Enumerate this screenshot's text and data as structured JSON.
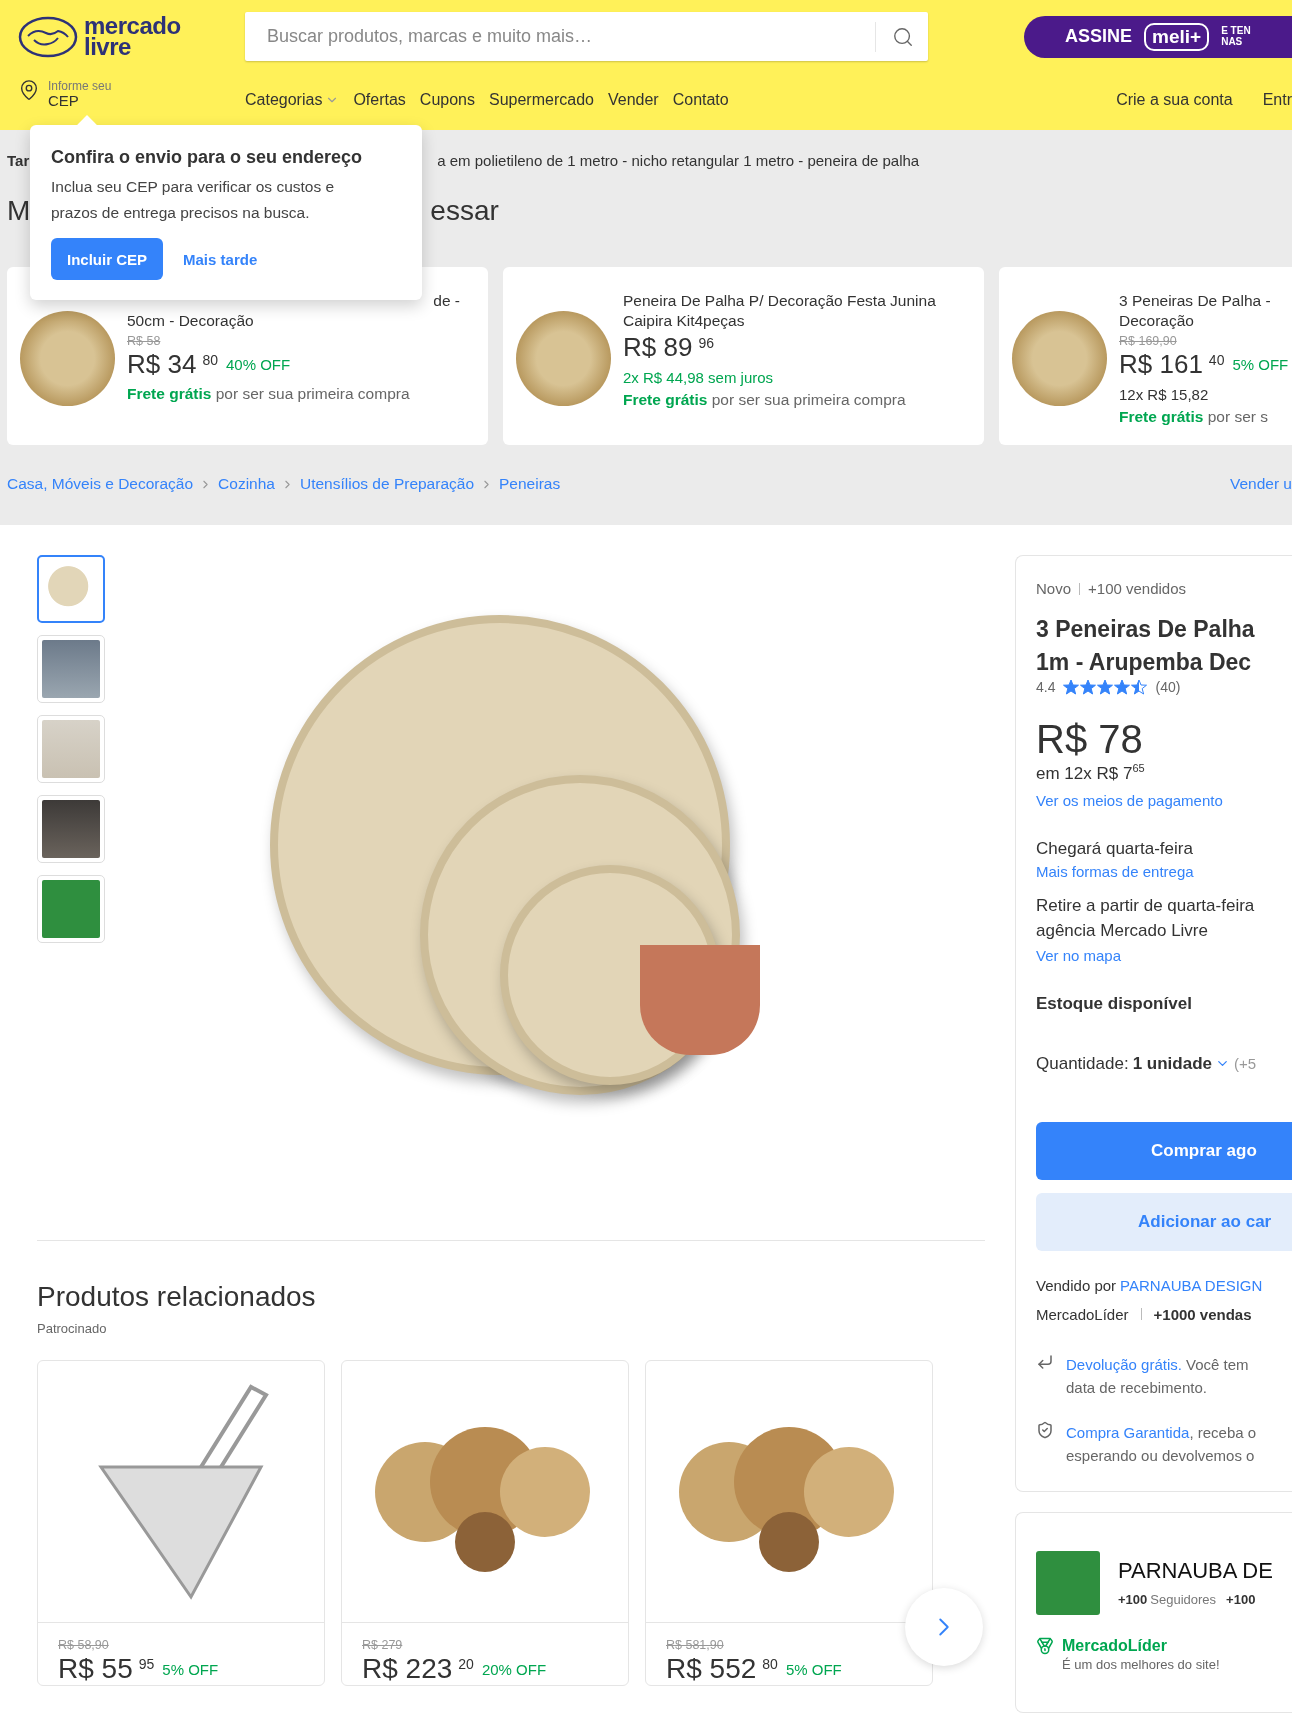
{
  "header": {
    "logo": {
      "line1": "mercado",
      "line2": "livre"
    },
    "search": {
      "placeholder": "Buscar produtos, marcas e muito mais…"
    },
    "promo": {
      "action": "ASSINE",
      "brand": "meli+",
      "tagline": [
        "E TEN",
        "NAS"
      ]
    },
    "location": {
      "label": "Informe seu",
      "value": "CEP"
    },
    "nav": [
      {
        "label": "Categorias",
        "dropdown": true
      },
      {
        "label": "Ofertas",
        "dropdown": false
      },
      {
        "label": "Cupons",
        "dropdown": false
      },
      {
        "label": "Supermercado",
        "dropdown": false
      },
      {
        "label": "Vender",
        "dropdown": false
      },
      {
        "label": "Contato",
        "dropdown": false
      }
    ],
    "account": [
      "Crie a sua conta",
      "Entr"
    ]
  },
  "popup": {
    "title": "Confira o envio para o seu endereço",
    "text": "Inclua seu CEP para verificar os custos e prazos de entrega precisos na busca.",
    "primary": "Incluir CEP",
    "secondary": "Mais tarde"
  },
  "search_context": {
    "prefix": "Tar",
    "text": "a em polietileno de 1 metro - nicho retangular 1 metro - peneira de palha"
  },
  "recommendations": {
    "heading_start": "M",
    "heading_end": "essar",
    "cards": [
      {
        "title_lines": [
          {
            "text": "de -",
            "partial": true
          },
          {
            "text": "50cm - Decoração",
            "partial": false
          }
        ],
        "old_price": "R$ 58",
        "price": "R$ 34",
        "cents": "80",
        "discount": "40% OFF",
        "shipping": {
          "highlight": "Frete grátis",
          "rest": "por ser sua primeira compra"
        }
      },
      {
        "title_lines": [
          {
            "text": "Peneira De Palha P/ Decoração Festa Junina",
            "partial": false
          },
          {
            "text": "Caipira Kit4peças",
            "partial": false
          }
        ],
        "price": "R$ 89",
        "cents": "96",
        "installments": {
          "text": "2x R$ 44,98 sem juros",
          "interest_free": true
        },
        "shipping": {
          "highlight": "Frete grátis",
          "rest": "por ser sua primeira compra"
        }
      },
      {
        "title_lines": [
          {
            "text": "3 Peneiras De Palha -",
            "partial": false
          },
          {
            "text": "Decoração",
            "partial": false
          }
        ],
        "old_price": "R$ 169,90",
        "price": "R$ 161",
        "cents": "40",
        "discount": "5% OFF",
        "installments": {
          "text": "12x R$ 15,82",
          "interest_free": false
        },
        "shipping": {
          "highlight": "Frete grátis",
          "rest": "por ser s"
        }
      }
    ]
  },
  "breadcrumb": {
    "items": [
      "Casa, Móveis e Decoração",
      "Cozinha",
      "Utensílios de Preparação",
      "Peneiras"
    ],
    "right_link": "Vender u"
  },
  "gallery": {
    "thumbnails": [
      {
        "selected": true
      },
      {
        "selected": false
      },
      {
        "selected": false
      },
      {
        "selected": false
      },
      {
        "selected": false
      }
    ]
  },
  "product": {
    "condition": "Novo",
    "sold": "+100 vendidos",
    "title_lines": [
      "3 Peneiras De Palha",
      "1m - Arupemba Dec"
    ],
    "rating": "4.4",
    "stars": 4.5,
    "reviews": "(40)",
    "price": "R$ 78",
    "installments": {
      "text": "em 12x R$ 7",
      "cents": "65"
    },
    "payment_link": "Ver os meios de pagamento",
    "delivery": "Chegará quarta-feira",
    "delivery_link": "Mais formas de entrega",
    "pickup_lines": [
      "Retire a partir de quarta-feira",
      "agência Mercado Livre"
    ],
    "map_link": "Ver no mapa",
    "stock": "Estoque disponível",
    "quantity": {
      "label": "Quantidade:",
      "value": "1 unidade",
      "extra": "(+5"
    },
    "buy_button": "Comprar ago",
    "cart_button": "Adicionar ao car",
    "seller": {
      "label": "Vendido por",
      "name": "PARNAUBA DESIGN",
      "badge": "MercadoLíder",
      "sales": "+1000 vendas"
    },
    "benefits": [
      {
        "kind": "return",
        "link": "Devolução grátis.",
        "rest": "Você tem",
        "line2": "data de recebimento."
      },
      {
        "kind": "guarantee",
        "link": "Compra Garantida",
        "rest": ", receba o",
        "line2": "esperando ou devolvemos o"
      }
    ]
  },
  "seller_card": {
    "name": "PARNAUBA DE",
    "stats": [
      {
        "value": "+100",
        "label": "Seguidores"
      },
      {
        "value": "+100"
      }
    ],
    "badge": "MercadoLíder",
    "note": "É um dos melhores do site!"
  },
  "related": {
    "heading": "Produtos relacionados",
    "sponsored": "Patrocinado",
    "cards": [
      {
        "kind": "strainer",
        "old_price": "R$ 58,90",
        "price": "R$ 55",
        "cents": "95",
        "discount": "5% OFF"
      },
      {
        "kind": "baskets",
        "old_price": "R$ 279",
        "price": "R$ 223",
        "cents": "20",
        "discount": "20% OFF"
      },
      {
        "kind": "baskets",
        "old_price": "R$ 581,90",
        "price": "R$ 552",
        "cents": "80",
        "discount": "5% OFF"
      }
    ]
  }
}
